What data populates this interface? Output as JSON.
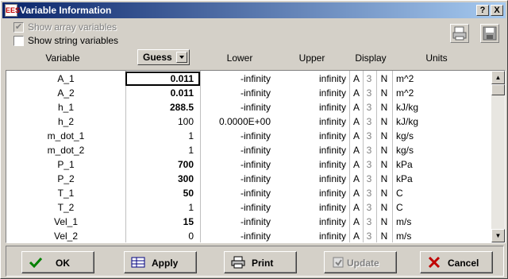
{
  "window": {
    "title": "Variable Information",
    "help_label": "?",
    "close_label": "X"
  },
  "options": {
    "show_array": {
      "label": "Show array variables",
      "checked": true,
      "disabled": true
    },
    "show_string": {
      "label": "Show string variables",
      "checked": false,
      "disabled": false
    }
  },
  "toolbar_icons": [
    "print-icon",
    "save-icon"
  ],
  "columns": {
    "variable": "Variable",
    "guess": "Guess",
    "lower": "Lower",
    "upper": "Upper",
    "display": "Display",
    "units": "Units"
  },
  "rows": [
    {
      "name": "A_1",
      "guess": "0.011",
      "guess_bold": true,
      "lower": "-infinity",
      "upper": "infinity",
      "fmt": "A",
      "digits": "3",
      "style": "N",
      "units": "m^2"
    },
    {
      "name": "A_2",
      "guess": "0.011",
      "guess_bold": true,
      "lower": "-infinity",
      "upper": "infinity",
      "fmt": "A",
      "digits": "3",
      "style": "N",
      "units": "m^2"
    },
    {
      "name": "h_1",
      "guess": "288.5",
      "guess_bold": true,
      "lower": "-infinity",
      "upper": "infinity",
      "fmt": "A",
      "digits": "3",
      "style": "N",
      "units": "kJ/kg"
    },
    {
      "name": "h_2",
      "guess": "100",
      "guess_bold": false,
      "lower": "0.0000E+00",
      "upper": "infinity",
      "fmt": "A",
      "digits": "3",
      "style": "N",
      "units": "kJ/kg"
    },
    {
      "name": "m_dot_1",
      "guess": "1",
      "guess_bold": false,
      "lower": "-infinity",
      "upper": "infinity",
      "fmt": "A",
      "digits": "3",
      "style": "N",
      "units": "kg/s"
    },
    {
      "name": "m_dot_2",
      "guess": "1",
      "guess_bold": false,
      "lower": "-infinity",
      "upper": "infinity",
      "fmt": "A",
      "digits": "3",
      "style": "N",
      "units": "kg/s"
    },
    {
      "name": "P_1",
      "guess": "700",
      "guess_bold": true,
      "lower": "-infinity",
      "upper": "infinity",
      "fmt": "A",
      "digits": "3",
      "style": "N",
      "units": "kPa"
    },
    {
      "name": "P_2",
      "guess": "300",
      "guess_bold": true,
      "lower": "-infinity",
      "upper": "infinity",
      "fmt": "A",
      "digits": "3",
      "style": "N",
      "units": "kPa"
    },
    {
      "name": "T_1",
      "guess": "50",
      "guess_bold": true,
      "lower": "-infinity",
      "upper": "infinity",
      "fmt": "A",
      "digits": "3",
      "style": "N",
      "units": "C"
    },
    {
      "name": "T_2",
      "guess": "1",
      "guess_bold": false,
      "lower": "-infinity",
      "upper": "infinity",
      "fmt": "A",
      "digits": "3",
      "style": "N",
      "units": "C"
    },
    {
      "name": "Vel_1",
      "guess": "15",
      "guess_bold": true,
      "lower": "-infinity",
      "upper": "infinity",
      "fmt": "A",
      "digits": "3",
      "style": "N",
      "units": "m/s"
    },
    {
      "name": "Vel_2",
      "guess": "0",
      "guess_bold": false,
      "lower": "-infinity",
      "upper": "infinity",
      "fmt": "A",
      "digits": "3",
      "style": "N",
      "units": "m/s"
    }
  ],
  "buttons": {
    "ok": "OK",
    "apply": "Apply",
    "print": "Print",
    "update": "Update",
    "cancel": "Cancel"
  },
  "colors": {
    "title_start": "#0a246a",
    "title_end": "#a6caf0",
    "ok_check": "#008000",
    "cancel_x": "#c00000"
  }
}
